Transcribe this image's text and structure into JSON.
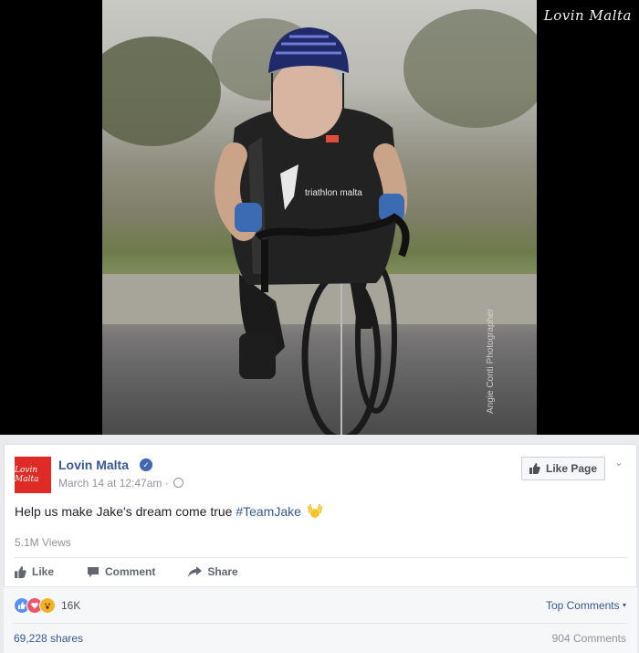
{
  "video": {
    "watermark": "Lovin Malta",
    "photo_credit": "Angie Conti Photographer",
    "jersey_text": "triathlon malta"
  },
  "post": {
    "page_name": "Lovin Malta",
    "avatar_text": "Lovin Malta",
    "timestamp": "March 14 at 12:47am",
    "dot": "·",
    "like_page_label": "Like Page",
    "message_text": "Help us make Jake's dream come true ",
    "hashtag": "#TeamJake",
    "views": "5.1M Views"
  },
  "actions": {
    "like": "Like",
    "comment": "Comment",
    "share": "Share"
  },
  "footer": {
    "reaction_count": "16K",
    "top_comments": "Top Comments",
    "shares": "69,228 shares",
    "comments": "904 Comments"
  },
  "colors": {
    "brand_blue": "#365899",
    "avatar_red": "#e02a26",
    "like_blue": "#5890ff",
    "love_red": "#f25268",
    "wow_yellow": "#f7b125"
  }
}
